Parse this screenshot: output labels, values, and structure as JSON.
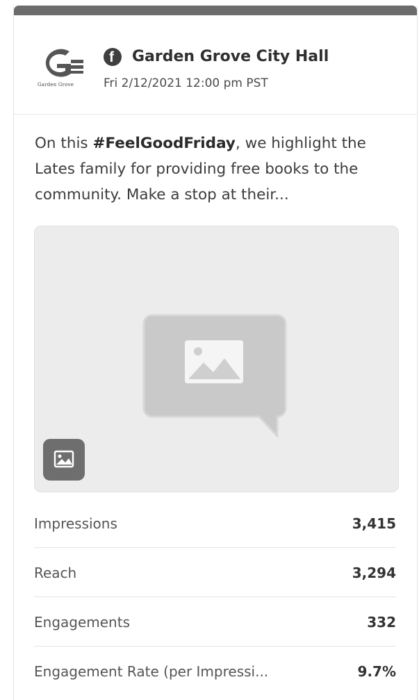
{
  "account": {
    "name": "Garden Grove City Hall",
    "logo_text": "Garden Grove",
    "network_icon": "facebook-icon"
  },
  "post": {
    "timestamp": "Fri 2/12/2021 12:00 pm PST",
    "text_prefix": "On this ",
    "hashtag": "#FeelGoodFriday",
    "text_suffix": ", we highlight the Lates family for providing free books to the community. Make a stop at their...",
    "media_icon": "image-placeholder-icon",
    "media_type_icon": "image-icon"
  },
  "metrics": [
    {
      "label": "Impressions",
      "value": "3,415"
    },
    {
      "label": "Reach",
      "value": "3,294"
    },
    {
      "label": "Engagements",
      "value": "332"
    },
    {
      "label": "Engagement Rate (per Impressi...",
      "value": "9.7%"
    }
  ],
  "colors": {
    "header_bar": "#6c6c6c",
    "text": "#3a3a3a",
    "media_bg": "#ececec"
  }
}
